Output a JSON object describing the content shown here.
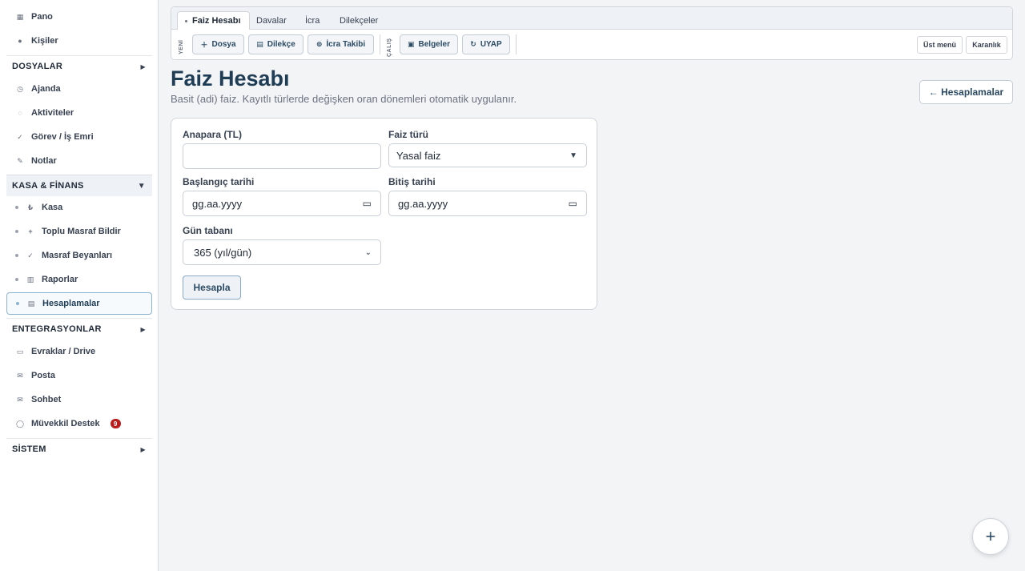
{
  "sidebar": {
    "top_items": [
      {
        "label": "Pano",
        "icon": "grid-icon"
      },
      {
        "label": "Kişiler",
        "icon": "users-icon"
      }
    ],
    "dosyalar": {
      "title": "DOSYALAR",
      "items": [
        {
          "label": "Ajanda",
          "icon": "calendar-icon"
        },
        {
          "label": "Aktiviteler",
          "icon": "activity-icon"
        },
        {
          "label": "Görev / İş Emri",
          "icon": "check-icon"
        },
        {
          "label": "Notlar",
          "icon": "pencil-icon"
        }
      ]
    },
    "kasa": {
      "title": "KASA & FİNANS",
      "items": [
        {
          "label": "Kasa",
          "icon": "lira-icon"
        },
        {
          "label": "Toplu Masraf Bildir",
          "icon": "plus-icon"
        },
        {
          "label": "Masraf Beyanları",
          "icon": "check-icon"
        },
        {
          "label": "Raporlar",
          "icon": "bar-chart-icon"
        },
        {
          "label": "Hesaplamalar",
          "icon": "calculator-icon",
          "active": true
        }
      ]
    },
    "entegrasyonlar": {
      "title": "ENTEGRASYONLAR",
      "items": [
        {
          "label": "Evraklar / Drive",
          "icon": "folder-icon"
        },
        {
          "label": "Posta",
          "icon": "mail-icon"
        },
        {
          "label": "Sohbet",
          "icon": "chat-icon"
        },
        {
          "label": "Müvekkil Destek",
          "icon": "support-icon",
          "badge": "9"
        }
      ]
    },
    "sistem": {
      "title": "SİSTEM"
    }
  },
  "toolbar": {
    "tabs": [
      "Faiz Hesabı",
      "Davalar",
      "İcra",
      "Dilekçeler"
    ],
    "new_label": "YENİ",
    "work_label": "ÇALIŞ",
    "buttons": {
      "dosya": "Dosya",
      "dilekce": "Dilekçe",
      "icra_takibi": "İcra Takibi",
      "belgeler": "Belgeler",
      "uyap": "UYAP"
    },
    "ust_menu": "Üst menü",
    "karanlik": "Karanlık"
  },
  "header": {
    "title": "Faiz Hesabı",
    "subtitle": "Basit (adi) faiz. Kayıtlı türlerde değişken oran dönemleri otomatik uygulanır.",
    "back_button": "← Hesaplamalar"
  },
  "form": {
    "anapara_label": "Anapara (TL)",
    "anapara_value": "",
    "faiz_turu_label": "Faiz türü",
    "faiz_turu_value": "Yasal faiz",
    "baslangic_label": "Başlangıç tarihi",
    "baslangic_placeholder": "gg.aa.yyyy",
    "bitis_label": "Bitiş tarihi",
    "bitis_placeholder": "gg.aa.yyyy",
    "gun_tabani_label": "Gün tabanı",
    "gun_tabani_value": "365 (yıl/gün)",
    "submit": "Hesapla"
  },
  "fab": {
    "label": "+"
  }
}
